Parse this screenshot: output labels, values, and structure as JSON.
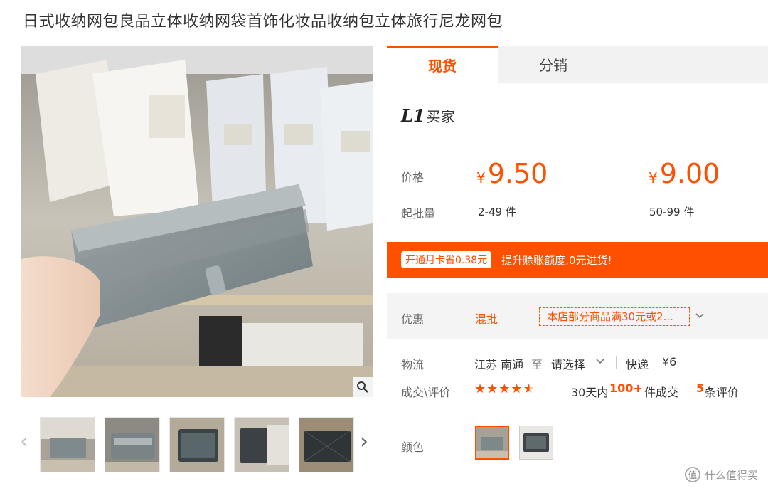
{
  "product": {
    "title": "日式收纳网包良品立体收纳网袋首饰化妆品收纳包立体旅行尼龙网包"
  },
  "tabs": [
    {
      "label": "现货"
    },
    {
      "label": "分销"
    }
  ],
  "buyer": {
    "level": "L1",
    "text": "买家"
  },
  "price": {
    "label": "价格",
    "currency": "¥",
    "tiers": [
      {
        "value": "9.50",
        "range": "2-49 件"
      },
      {
        "value": "9.00",
        "range": "50-99 件"
      }
    ],
    "min_label": "起批量"
  },
  "promo": {
    "tag": "开通月卡省0.38元",
    "text": "提升赊账额度,0元进货!"
  },
  "discount": {
    "label": "优惠",
    "type": "混批",
    "coupon": "本店部分商品满30元或2..."
  },
  "logistics": {
    "label": "物流",
    "from": "江苏 南通",
    "to_word": "至",
    "select": "请选择",
    "method": "快递",
    "fee": "¥6"
  },
  "trade": {
    "label": "成交\\评价",
    "period": "30天内",
    "count": "100+",
    "count_unit": "件成交",
    "reviews": "5",
    "reviews_unit": "条评价",
    "rating": 4.5
  },
  "color": {
    "label": "颜色"
  },
  "watermark": {
    "text": "什么值得买",
    "icon": "值"
  },
  "icons": {
    "zoom": "magnifier-icon",
    "prev": "chevron-left-icon",
    "next": "chevron-right-icon",
    "dropdown": "chevron-down-icon"
  },
  "accent": "#ff5000"
}
